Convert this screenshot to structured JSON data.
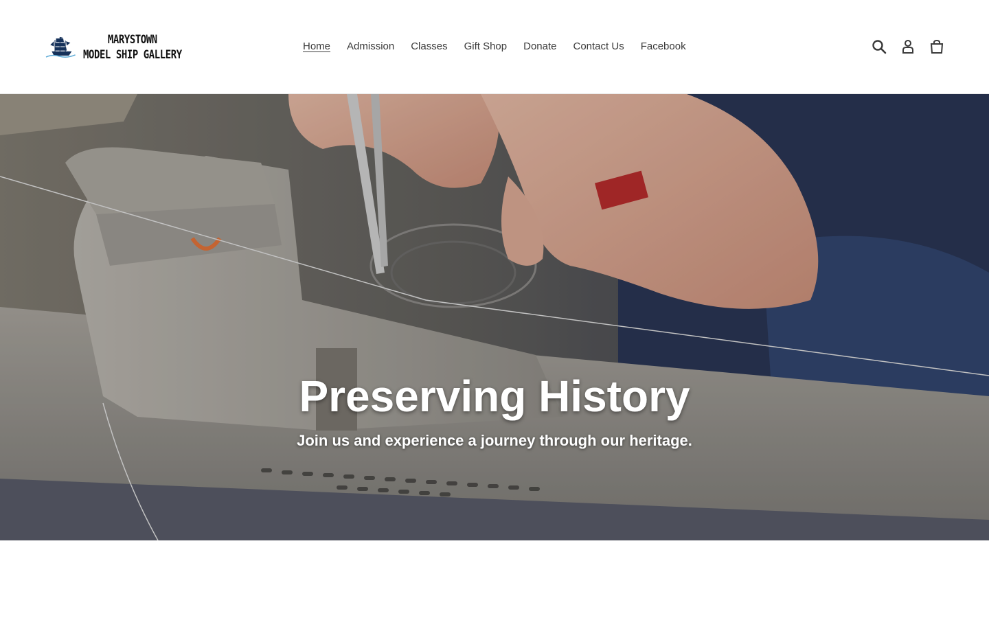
{
  "brand": {
    "name_line1": "MARYSTOWN",
    "name_line2": "MODEL SHIP GALLERY"
  },
  "nav": {
    "items": [
      {
        "label": "Home",
        "active": true
      },
      {
        "label": "Admission"
      },
      {
        "label": "Classes"
      },
      {
        "label": "Gift Shop"
      },
      {
        "label": "Donate"
      },
      {
        "label": "Contact Us"
      },
      {
        "label": "Facebook"
      }
    ]
  },
  "header_icons": [
    "search-icon",
    "account-icon",
    "cart-icon"
  ],
  "hero": {
    "title": "Preserving History",
    "subtitle": "Join us and experience a journey through our heritage."
  },
  "colors": {
    "brand_navy": "#15315a",
    "wave_blue": "#5aa9d6",
    "text": "#3a3a3a"
  }
}
